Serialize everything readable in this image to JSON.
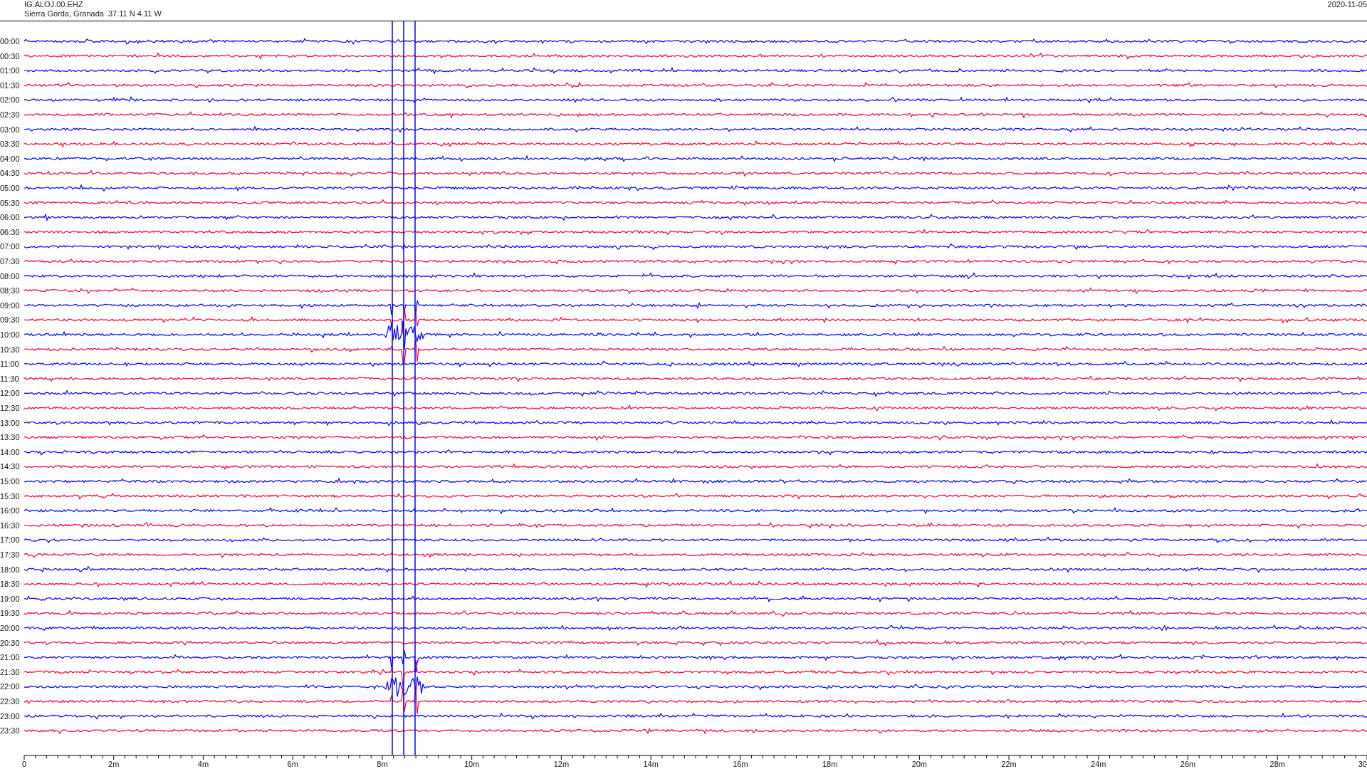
{
  "header": {
    "station": "IG.ALOJ.00.EHZ",
    "location": "Sierra Gorda, Granada  37.11 N 4.11 W",
    "date": "2020-11-05"
  },
  "traces": [
    {
      "label": "00:00",
      "color": "#0000ff"
    },
    {
      "label": "00:30",
      "color": "#ff0033"
    },
    {
      "label": "01:00",
      "color": "#0000ff"
    },
    {
      "label": "01:30",
      "color": "#ff0033"
    },
    {
      "label": "02:00",
      "color": "#0000ff"
    },
    {
      "label": "02:30",
      "color": "#ff0033"
    },
    {
      "label": "03:00",
      "color": "#0000ff"
    },
    {
      "label": "03:30",
      "color": "#ff0033"
    },
    {
      "label": "04:00",
      "color": "#0000ff"
    },
    {
      "label": "04:30",
      "color": "#ff0033"
    },
    {
      "label": "05:00",
      "color": "#0000ff"
    },
    {
      "label": "05:30",
      "color": "#ff0033"
    },
    {
      "label": "06:00",
      "color": "#0000ff"
    },
    {
      "label": "06:30",
      "color": "#ff0033"
    },
    {
      "label": "07:00",
      "color": "#0000ff"
    },
    {
      "label": "07:30",
      "color": "#ff0033"
    },
    {
      "label": "08:00",
      "color": "#0000ff"
    },
    {
      "label": "08:30",
      "color": "#ff0033"
    },
    {
      "label": "09:00",
      "color": "#0000ff"
    },
    {
      "label": "09:30",
      "color": "#ff0033"
    },
    {
      "label": "10:00",
      "color": "#0000ff"
    },
    {
      "label": "10:30",
      "color": "#ff0033"
    },
    {
      "label": "11:00",
      "color": "#0000ff"
    },
    {
      "label": "11:30",
      "color": "#ff0033"
    },
    {
      "label": "12:00",
      "color": "#0000ff"
    },
    {
      "label": "12:30",
      "color": "#ff0033"
    },
    {
      "label": "13:00",
      "color": "#0000ff"
    },
    {
      "label": "13:30",
      "color": "#ff0033"
    },
    {
      "label": "14:00",
      "color": "#0000ff"
    },
    {
      "label": "14:30",
      "color": "#ff0033"
    },
    {
      "label": "15:00",
      "color": "#0000ff"
    },
    {
      "label": "15:30",
      "color": "#ff0033"
    },
    {
      "label": "16:00",
      "color": "#0000ff"
    },
    {
      "label": "16:30",
      "color": "#ff0033"
    },
    {
      "label": "17:00",
      "color": "#0000ff"
    },
    {
      "label": "17:30",
      "color": "#ff0033"
    },
    {
      "label": "18:00",
      "color": "#0000ff"
    },
    {
      "label": "18:30",
      "color": "#ff0033"
    },
    {
      "label": "19:00",
      "color": "#0000ff"
    },
    {
      "label": "19:30",
      "color": "#ff0033"
    },
    {
      "label": "20:00",
      "color": "#0000ff"
    },
    {
      "label": "20:30",
      "color": "#ff0033"
    },
    {
      "label": "21:00",
      "color": "#0000ff"
    },
    {
      "label": "21:30",
      "color": "#ff0033"
    },
    {
      "label": "22:00",
      "color": "#0000ff"
    },
    {
      "label": "22:30",
      "color": "#ff0033"
    },
    {
      "label": "23:00",
      "color": "#0000ff"
    },
    {
      "label": "23:30",
      "color": "#ff0033"
    }
  ],
  "x_axis": {
    "ticks": [
      "0",
      "2m",
      "4m",
      "6m",
      "8m",
      "10m",
      "12m",
      "14m",
      "16m",
      "18m",
      "20m",
      "22m",
      "24m",
      "26m",
      "28m",
      "30"
    ]
  }
}
